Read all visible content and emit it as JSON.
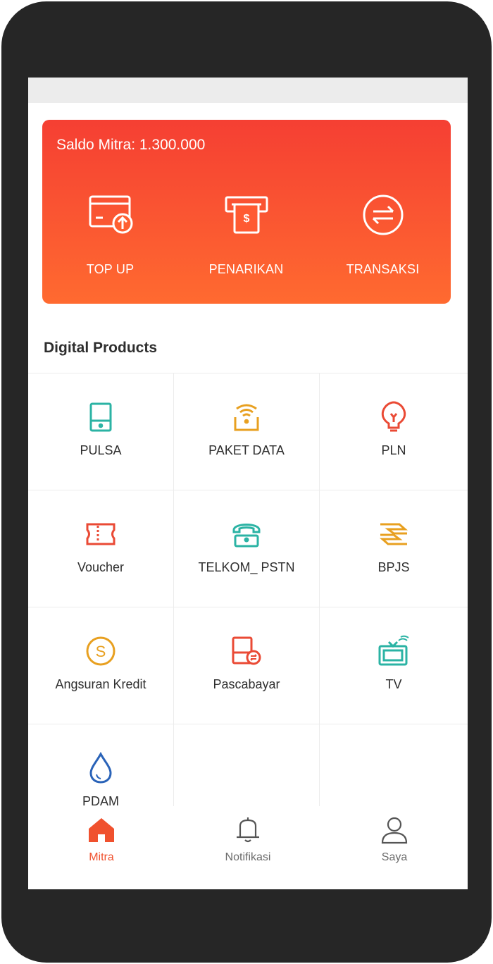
{
  "balance": {
    "label": "Saldo Mitra: 1.300.000"
  },
  "actions": [
    {
      "label": "TOP UP",
      "icon": "card-upload-icon"
    },
    {
      "label": "PENARIKAN",
      "icon": "atm-withdraw-icon"
    },
    {
      "label": "TRANSAKSI",
      "icon": "transfer-arrows-icon"
    }
  ],
  "section": {
    "title": "Digital Products"
  },
  "products": [
    {
      "label": "PULSA",
      "icon": "phone-icon",
      "color": "#2bb3a4"
    },
    {
      "label": "PAKET DATA",
      "icon": "wifi-icon",
      "color": "#e8a020"
    },
    {
      "label": "PLN",
      "icon": "lightbulb-icon",
      "color": "#ea4a35"
    },
    {
      "label": "Voucher",
      "icon": "ticket-icon",
      "color": "#ea4a35"
    },
    {
      "label": "TELKOM_ PSTN",
      "icon": "telephone-icon",
      "color": "#2bb3a4"
    },
    {
      "label": "BPJS",
      "icon": "hands-icon",
      "color": "#e8a020"
    },
    {
      "label": "Angsuran Kredit",
      "icon": "coin-icon",
      "color": "#e8a020"
    },
    {
      "label": "Pascabayar",
      "icon": "postpaid-phone-icon",
      "color": "#ea4a35"
    },
    {
      "label": "TV",
      "icon": "tv-icon",
      "color": "#2bb3a4"
    },
    {
      "label": "PDAM",
      "icon": "water-drop-icon",
      "color": "#2a63b8"
    }
  ],
  "nav": [
    {
      "label": "Mitra",
      "icon": "home-icon",
      "active": true
    },
    {
      "label": "Notifikasi",
      "icon": "bell-icon",
      "active": false
    },
    {
      "label": "Saya",
      "icon": "user-icon",
      "active": false
    }
  ],
  "colors": {
    "accent": "#f0512e",
    "card_top": "#f53f33",
    "card_bottom": "#ff6a30"
  }
}
